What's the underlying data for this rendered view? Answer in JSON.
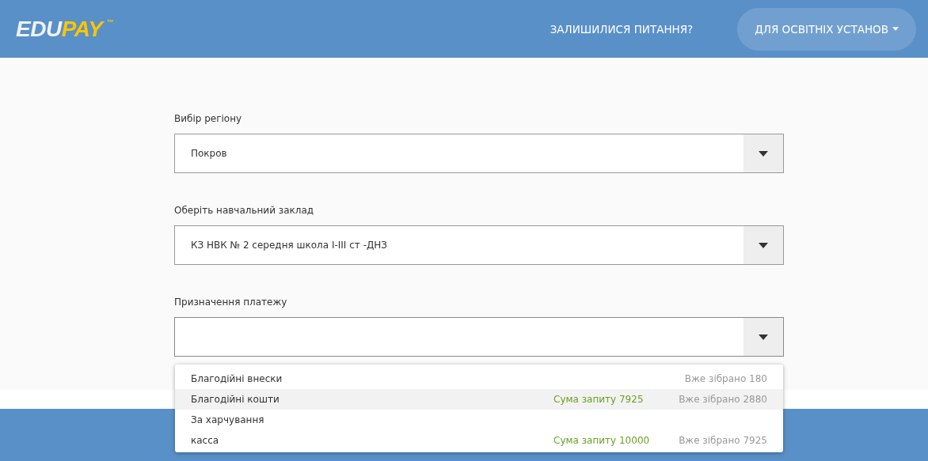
{
  "header": {
    "logo": {
      "part_1": "EDU",
      "part_2": "PAY",
      "mark": "™"
    },
    "nav": [
      {
        "label": "ЗАЛИШИЛИСЯ ПИТАННЯ?",
        "kind": "link"
      },
      {
        "label": "ДЛЯ ОСВІТНІХ УСТАНОВ",
        "kind": "pill"
      }
    ]
  },
  "form": {
    "fields": [
      {
        "label": "Вибір регіону",
        "value": "Покров"
      },
      {
        "label": "Оберіть навчальний заклад",
        "value": "КЗ НВК № 2 середня школа I-III ст -ДНЗ"
      },
      {
        "label": "Призначення платежу",
        "open": true
      }
    ]
  },
  "dropdown": {
    "options": [
      {
        "name": "Благодійні внески",
        "selected": false,
        "collected": "Вже зібрано 180"
      },
      {
        "name": "Благодійні кошти",
        "selected": true,
        "request": "Сума запиту 7925",
        "collected": "Вже зібрано 2880"
      },
      {
        "name": "За харчування",
        "selected": false
      },
      {
        "name": "касса",
        "selected": false,
        "request": "Сума запиту 10000",
        "collected": "Вже зібрано 7925"
      }
    ]
  }
}
